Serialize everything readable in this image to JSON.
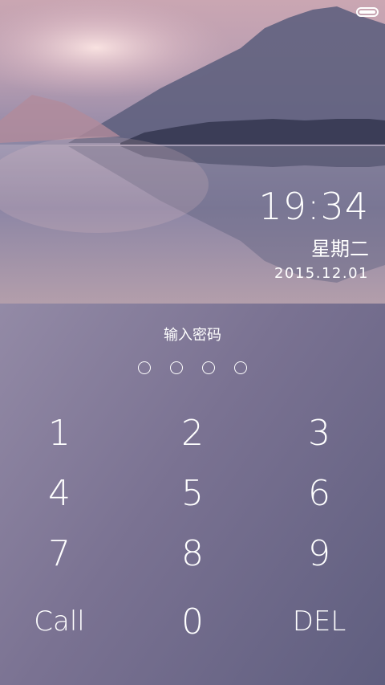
{
  "status": {
    "battery_icon": "battery-icon"
  },
  "clock": {
    "time": "19:34",
    "weekday": "星期二",
    "date": "2015.12.01"
  },
  "lock": {
    "prompt": "输入密码",
    "pin_dots": 4
  },
  "keypad": {
    "k1": "1",
    "k2": "2",
    "k3": "3",
    "k4": "4",
    "k5": "5",
    "k6": "6",
    "k7": "7",
    "k8": "8",
    "k9": "9",
    "call": "Call",
    "k0": "0",
    "del": "DEL"
  }
}
